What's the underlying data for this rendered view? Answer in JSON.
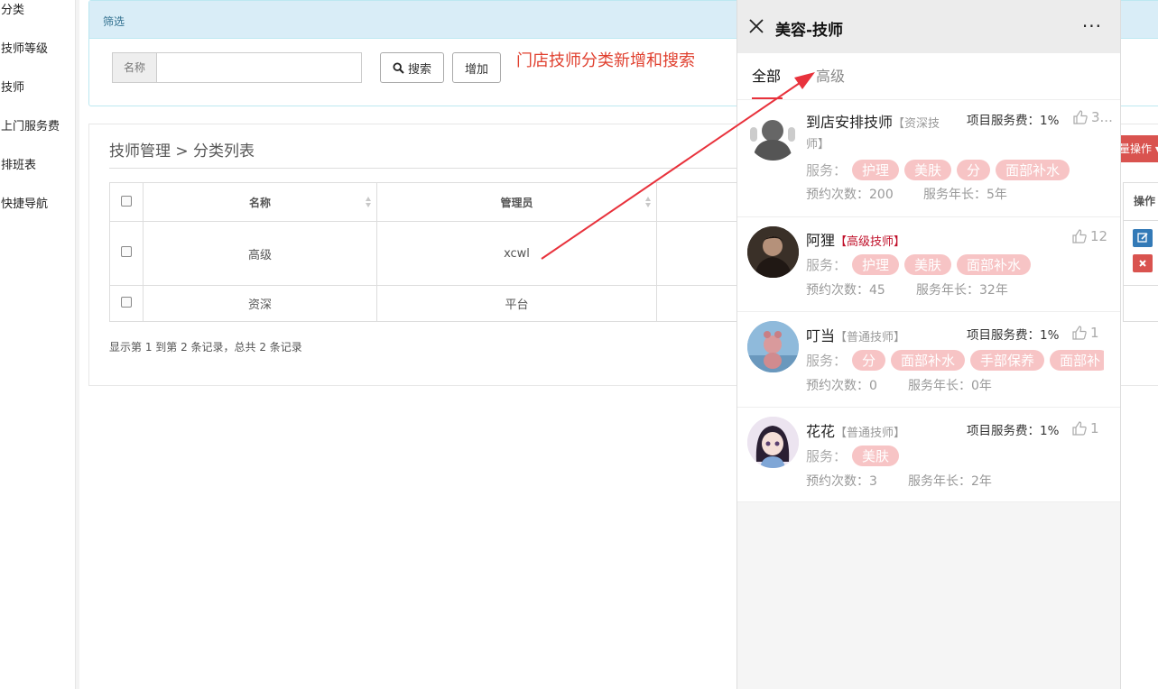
{
  "sidebar": {
    "items": [
      "分类",
      "技师等级",
      "技师",
      "上门服务费",
      "排班表",
      "快捷导航"
    ]
  },
  "filter": {
    "title": "筛选",
    "name_label": "名称",
    "name_value": "",
    "search_label": "搜索",
    "add_label": "增加"
  },
  "annotation": "门店技师分类新增和搜索",
  "list": {
    "breadcrumb": "技师管理 > 分类列表",
    "columns": [
      "名称",
      "管理员"
    ],
    "rows": [
      {
        "name": "高级",
        "admin": "xcwl"
      },
      {
        "name": "资深",
        "admin": "平台"
      }
    ],
    "pager": "显示第 1 到第 2 条记录，总共 2 条记录",
    "batch_label": "量操作",
    "op_column": "操作"
  },
  "phone": {
    "title": "美容-技师",
    "more": "···",
    "tabs": [
      {
        "label": "全部",
        "active": true
      },
      {
        "label": "高级",
        "active": false
      }
    ],
    "techs": [
      {
        "name": "到店安排技师",
        "level": "【资深技",
        "level2": "师】",
        "fee": "项目服务费：1%",
        "likes": "3...",
        "services": [
          "护理",
          "美肤",
          "分",
          "面部补水"
        ],
        "bookings": "预约次数：200",
        "years": "服务年长：5年"
      },
      {
        "name": "阿狸",
        "level": "【高级技师】",
        "fee": "",
        "likes": "12",
        "services": [
          "护理",
          "美肤",
          "面部补水"
        ],
        "bookings": "预约次数：45",
        "years": "服务年长：32年"
      },
      {
        "name": "叮当",
        "level": "【普通技师】",
        "fee": "项目服务费：1%",
        "likes": "1",
        "services": [
          "分",
          "面部补水",
          "手部保养",
          "面部补"
        ],
        "bookings": "预约次数：0",
        "years": "服务年长：0年"
      },
      {
        "name": "花花",
        "level": "【普通技师】",
        "fee": "项目服务费：1%",
        "likes": "1",
        "services": [
          "美肤"
        ],
        "bookings": "预约次数：3",
        "years": "服务年长：2年"
      }
    ],
    "service_label": "服务："
  },
  "colors": {
    "tag_bg": "#f7c4c5",
    "accent_red": "#e8323c",
    "annotation": "#e0402f",
    "panel_head": "#d9edf7"
  }
}
